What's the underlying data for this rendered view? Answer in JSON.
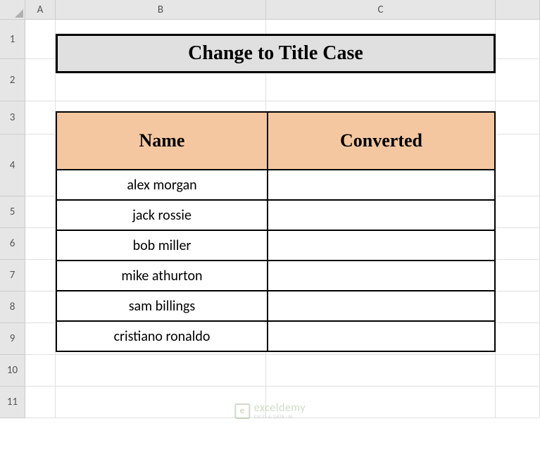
{
  "columns": [
    "A",
    "B",
    "C"
  ],
  "rows": [
    "1",
    "2",
    "3",
    "4",
    "5",
    "6",
    "7",
    "8",
    "9",
    "10",
    "11"
  ],
  "title": "Change to Title Case",
  "table": {
    "headers": [
      "Name",
      "Converted"
    ],
    "data": [
      {
        "name": "alex morgan",
        "converted": ""
      },
      {
        "name": "jack rossie",
        "converted": ""
      },
      {
        "name": "bob miller",
        "converted": ""
      },
      {
        "name": "mike athurton",
        "converted": ""
      },
      {
        "name": "sam billings",
        "converted": ""
      },
      {
        "name": "cristiano ronaldo",
        "converted": ""
      }
    ]
  },
  "watermark": {
    "brand": "exceldemy",
    "tagline": "EXCEL & DATA · BI"
  }
}
